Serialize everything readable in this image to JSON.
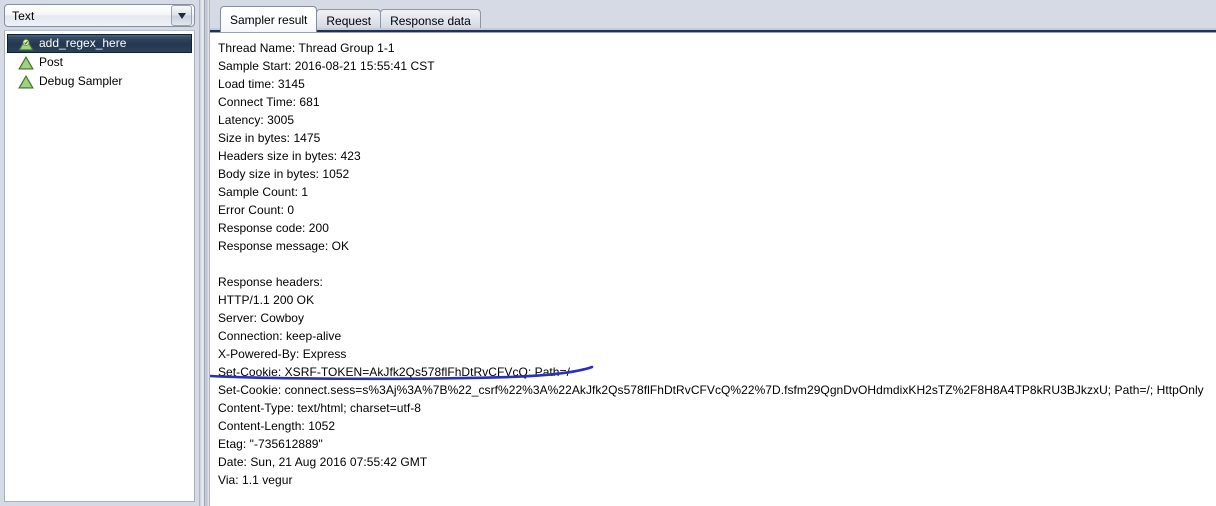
{
  "left_panel": {
    "combo": {
      "value": "Text",
      "arrow_icon": "chevron-down-icon"
    },
    "tree_items": [
      {
        "label": "add_regex_here",
        "icon": "green-warning-triangle-icon",
        "selected": true
      },
      {
        "label": "Post",
        "icon": "green-warning-triangle-icon",
        "selected": false
      },
      {
        "label": "Debug Sampler",
        "icon": "green-warning-triangle-icon",
        "selected": false
      }
    ]
  },
  "tabs": [
    {
      "label": "Sampler result",
      "active": true
    },
    {
      "label": "Request",
      "active": false
    },
    {
      "label": "Response data",
      "active": false
    }
  ],
  "sampler_result": {
    "lines": [
      "Thread Name: Thread Group 1-1",
      "Sample Start: 2016-08-21 15:55:41 CST",
      "Load time: 3145",
      "Connect Time: 681",
      "Latency: 3005",
      "Size in bytes: 1475",
      "Headers size in bytes: 423",
      "Body size in bytes: 1052",
      "Sample Count: 1",
      "Error Count: 0",
      "Response code: 200",
      "Response message: OK",
      "",
      "Response headers:",
      "HTTP/1.1 200 OK",
      "Server: Cowboy",
      "Connection: keep-alive",
      "X-Powered-By: Express",
      "Set-Cookie: XSRF-TOKEN=AkJfk2Qs578flFhDtRvCFVcQ; Path=/",
      "Set-Cookie: connect.sess=s%3Aj%3A%7B%22_csrf%22%3A%22AkJfk2Qs578flFhDtRvCFVcQ%22%7D.fsfm29QgnDvOHdmdixKH2sTZ%2F8H8A4TP8kRU3BJkzxU; Path=/; HttpOnly",
      "Content-Type: text/html; charset=utf-8",
      "Content-Length: 1052",
      "Etag: \"-735612889\"",
      "Date: Sun, 21 Aug 2016 07:55:42 GMT",
      "Via: 1.1 vegur"
    ]
  },
  "annotation": {
    "name": "blue-underline-annotation",
    "color": "#2a2fc0",
    "targets_line": "Set-Cookie: XSRF-TOKEN=AkJfk2Qs578flFhDtRvCFVcQ; Path=/"
  },
  "colors": {
    "selection": "#2c4259",
    "tab_active_bg": "#ffffff",
    "panel_bg": "#d6dae4",
    "content_bg": "#ffffff",
    "annotation_blue": "#2a2fc0",
    "icon_green": "#6aa84f"
  }
}
